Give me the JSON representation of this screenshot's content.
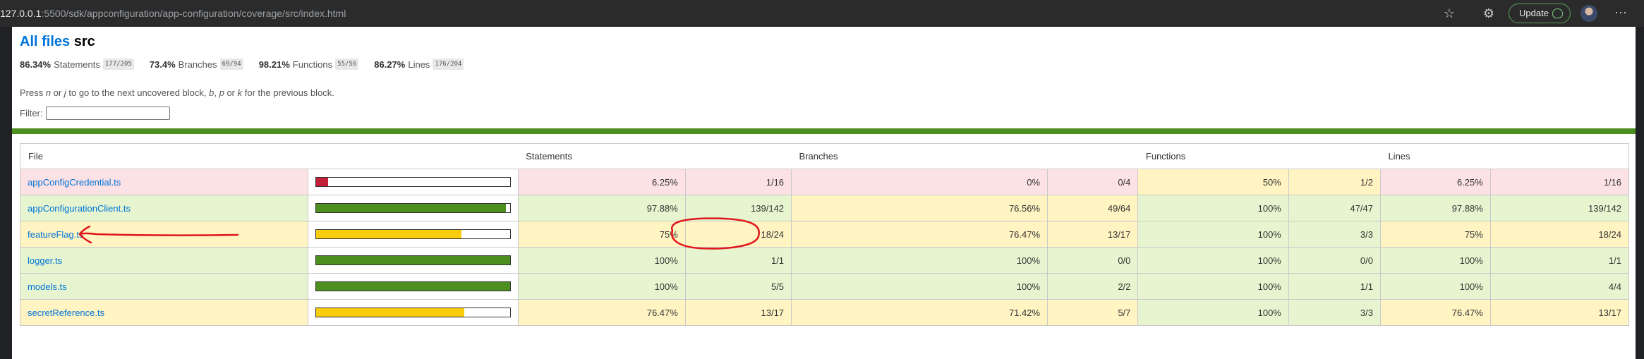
{
  "browser": {
    "url_host": "127.0.0.1",
    "url_path": ":5500/sdk/appconfiguration/app-configuration/coverage/src/index.html",
    "update_label": "Update"
  },
  "header": {
    "all_files_link": "All files",
    "dir_name": "src"
  },
  "summary": [
    {
      "pct": "86.34%",
      "label": "Statements",
      "fraction": "177/205"
    },
    {
      "pct": "73.4%",
      "label": "Branches",
      "fraction": "69/94"
    },
    {
      "pct": "98.21%",
      "label": "Functions",
      "fraction": "55/56"
    },
    {
      "pct": "86.27%",
      "label": "Lines",
      "fraction": "176/204"
    }
  ],
  "hint": {
    "p1": "Press ",
    "n": "n",
    "p2": " or ",
    "j": "j",
    "p3": " to go to the next uncovered block, ",
    "b": "b",
    "p4": ", ",
    "p": "p",
    "p5": " or ",
    "k": "k",
    "p6": " for the previous block."
  },
  "filter": {
    "label": "Filter:",
    "value": ""
  },
  "table": {
    "headers": {
      "file": "File",
      "statements": "Statements",
      "branches": "Branches",
      "functions": "Functions",
      "lines": "Lines"
    },
    "rows": [
      {
        "file": "appConfigCredential.ts",
        "level": "low",
        "fill_pct": 6.25,
        "stmt_pct": "6.25%",
        "stmt_frac": "1/16",
        "stmt_level": "low",
        "br_pct": "0%",
        "br_frac": "0/4",
        "br_level": "low",
        "fn_pct": "50%",
        "fn_frac": "1/2",
        "fn_level": "medium",
        "ln_pct": "6.25%",
        "ln_frac": "1/16",
        "ln_level": "low"
      },
      {
        "file": "appConfigurationClient.ts",
        "level": "high",
        "fill_pct": 97.88,
        "stmt_pct": "97.88%",
        "stmt_frac": "139/142",
        "stmt_level": "high",
        "br_pct": "76.56%",
        "br_frac": "49/64",
        "br_level": "medium",
        "fn_pct": "100%",
        "fn_frac": "47/47",
        "fn_level": "high",
        "ln_pct": "97.88%",
        "ln_frac": "139/142",
        "ln_level": "high"
      },
      {
        "file": "featureFlag.ts",
        "level": "medium",
        "fill_pct": 75,
        "stmt_pct": "75%",
        "stmt_frac": "18/24",
        "stmt_level": "medium",
        "br_pct": "76.47%",
        "br_frac": "13/17",
        "br_level": "medium",
        "fn_pct": "100%",
        "fn_frac": "3/3",
        "fn_level": "high",
        "ln_pct": "75%",
        "ln_frac": "18/24",
        "ln_level": "medium"
      },
      {
        "file": "logger.ts",
        "level": "high",
        "fill_pct": 100,
        "stmt_pct": "100%",
        "stmt_frac": "1/1",
        "stmt_level": "high",
        "br_pct": "100%",
        "br_frac": "0/0",
        "br_level": "high",
        "fn_pct": "100%",
        "fn_frac": "0/0",
        "fn_level": "high",
        "ln_pct": "100%",
        "ln_frac": "1/1",
        "ln_level": "high"
      },
      {
        "file": "models.ts",
        "level": "high",
        "fill_pct": 100,
        "stmt_pct": "100%",
        "stmt_frac": "5/5",
        "stmt_level": "high",
        "br_pct": "100%",
        "br_frac": "2/2",
        "br_level": "high",
        "fn_pct": "100%",
        "fn_frac": "1/1",
        "fn_level": "high",
        "ln_pct": "100%",
        "ln_frac": "4/4",
        "ln_level": "high"
      },
      {
        "file": "secretReference.ts",
        "level": "medium",
        "fill_pct": 76.47,
        "stmt_pct": "76.47%",
        "stmt_frac": "13/17",
        "stmt_level": "medium",
        "br_pct": "71.42%",
        "br_frac": "5/7",
        "br_level": "medium",
        "fn_pct": "100%",
        "fn_frac": "3/3",
        "fn_level": "high",
        "ln_pct": "76.47%",
        "ln_frac": "13/17",
        "ln_level": "medium"
      }
    ]
  },
  "colors": {
    "low": "#fce1e5",
    "medium": "#fff4c2",
    "high": "#e6f5d0",
    "bar_low": "#c21f39",
    "bar_medium": "#f9cd0b",
    "bar_high": "#4d8f1f",
    "annotation": "#e0161b",
    "link": "#0074d9"
  }
}
